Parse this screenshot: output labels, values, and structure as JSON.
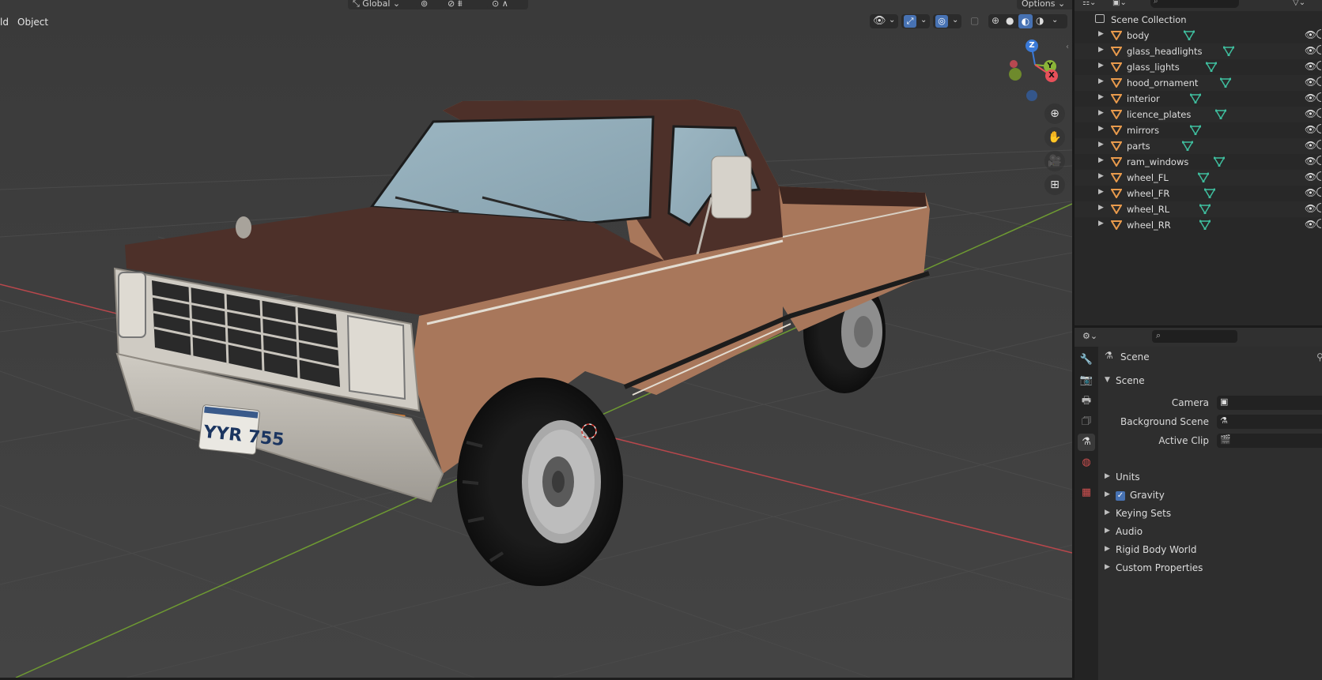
{
  "viewport": {
    "menus": [
      "ld",
      "Object"
    ],
    "orientation_label": "Global",
    "options_label": "Options",
    "license_plate": "YYR 755",
    "gizmo_axes": [
      "Z",
      "Y",
      "X"
    ],
    "colors": {
      "grid_bg": "#3d3d3d",
      "x_axis": "#b8474c",
      "y_axis": "#6e9a32",
      "truck_lower": "#a8775b",
      "truck_upper": "#4d3029"
    }
  },
  "outliner": {
    "collection": "Scene Collection",
    "objects": [
      {
        "name": "body"
      },
      {
        "name": "glass_headlights"
      },
      {
        "name": "glass_lights"
      },
      {
        "name": "hood_ornament"
      },
      {
        "name": "interior"
      },
      {
        "name": "licence_plates"
      },
      {
        "name": "mirrors"
      },
      {
        "name": "parts"
      },
      {
        "name": "ram_windows"
      },
      {
        "name": "wheel_FL"
      },
      {
        "name": "wheel_FR"
      },
      {
        "name": "wheel_RL"
      },
      {
        "name": "wheel_RR"
      }
    ]
  },
  "properties": {
    "context_title": "Scene",
    "section_title": "Scene",
    "fields": [
      {
        "label": "Camera",
        "value": ""
      },
      {
        "label": "Background Scene",
        "value": ""
      },
      {
        "label": "Active Clip",
        "value": ""
      }
    ],
    "panels": [
      {
        "label": "Units",
        "checkbox": false
      },
      {
        "label": "Gravity",
        "checkbox": true
      },
      {
        "label": "Keying Sets",
        "checkbox": false
      },
      {
        "label": "Audio",
        "checkbox": false
      },
      {
        "label": "Rigid Body World",
        "checkbox": false
      },
      {
        "label": "Custom Properties",
        "checkbox": false
      }
    ]
  }
}
